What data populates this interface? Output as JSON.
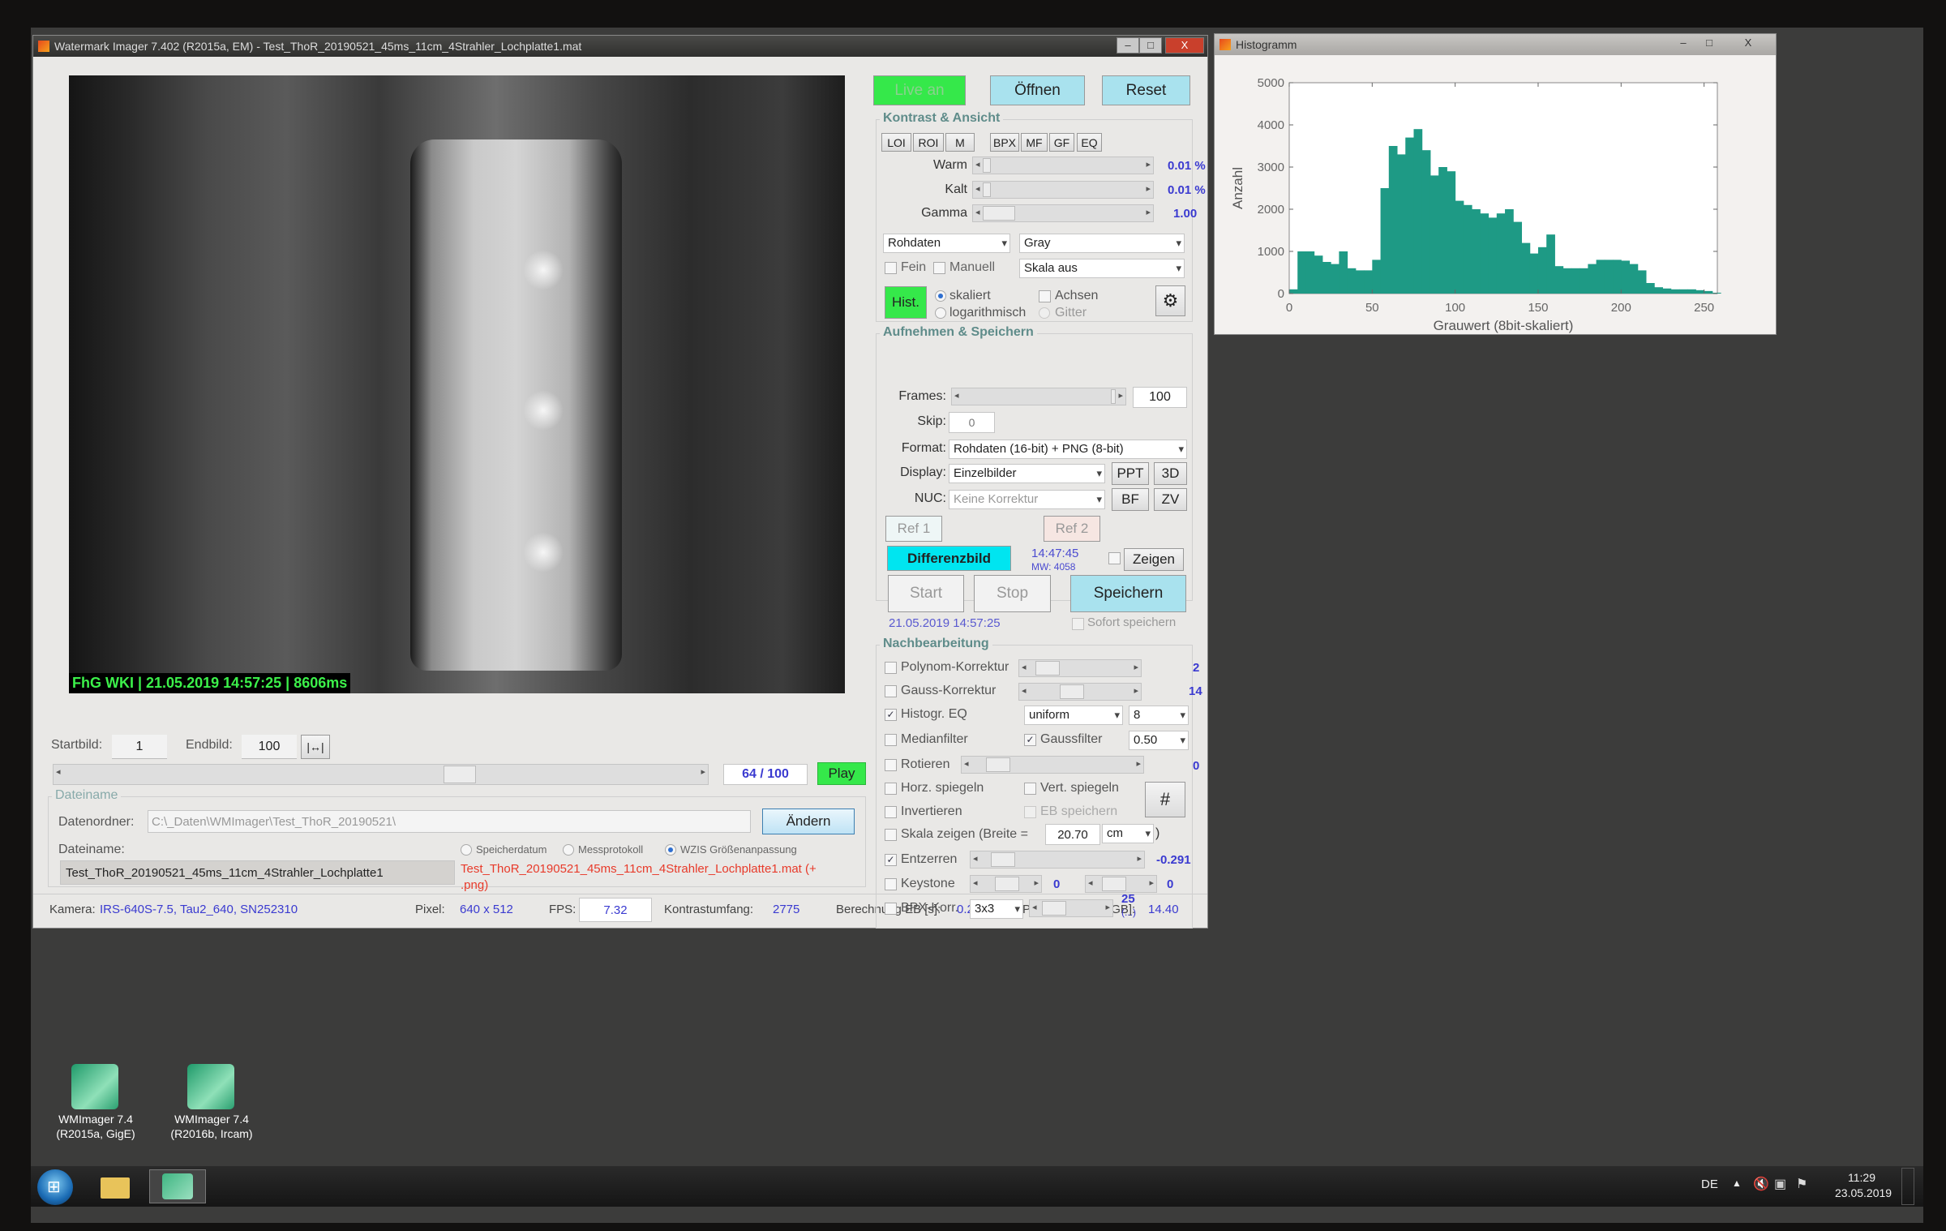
{
  "main_window": {
    "title": "Watermark Imager 7.402 (R2015a, EM) - Test_ThoR_20190521_45ms_11cm_4Strahler_Lochplatte1.mat",
    "overlay": "FhG WKI | 21.05.2019 14:57:25 | 8606ms"
  },
  "histogram_window": {
    "title": "Histogramm"
  },
  "window_buttons": {
    "min": "–",
    "max": "□",
    "close": "X"
  },
  "top_buttons": {
    "live": "Live an",
    "open": "Öffnen",
    "reset": "Reset"
  },
  "colors": {
    "green": "#35e84a",
    "cyan_light": "#a9e2ee",
    "cyan": "#00e5f0",
    "value_blue": "#3a3ad0",
    "red_text": "#e83a2a",
    "hist_fill": "#1e9a85"
  },
  "kontrast": {
    "title": "Kontrast & Ansicht",
    "tool_buttons": [
      "LOI",
      "ROI",
      "M",
      "BPX",
      "MF",
      "GF",
      "EQ"
    ],
    "warm_label": "Warm",
    "warm_value": "0.01 %",
    "kalt_label": "Kalt",
    "kalt_value": "0.01 %",
    "gamma_label": "Gamma",
    "gamma_value": "1.00",
    "data_select": "Rohdaten",
    "colormap_select": "Gray",
    "scale_select": "Skala aus",
    "fein": "Fein",
    "manuell": "Manuell",
    "hist_button": "Hist.",
    "skaliert": "skaliert",
    "log": "logarithmisch",
    "achsen": "Achsen",
    "gitter": "Gitter"
  },
  "aufnehmen": {
    "title": "Aufnehmen & Speichern",
    "frames_label": "Frames:",
    "frames_value": "100",
    "skip_label": "Skip:",
    "skip_value": "0",
    "format_label": "Format:",
    "format_value": "Rohdaten (16-bit) + PNG (8-bit)",
    "display_label": "Display:",
    "display_value": "Einzelbilder",
    "nuc_label": "NUC:",
    "nuc_value": "Keine Korrektur",
    "ppt": "PPT",
    "d3": "3D",
    "bf": "BF",
    "zv": "ZV",
    "ref1": "Ref 1",
    "ref2": "Ref 2",
    "diff": "Differenzbild",
    "ref_time": "14:47:45",
    "ref_mw": "MW: 4058",
    "zeigen": "Zeigen",
    "start": "Start",
    "stop": "Stop",
    "speichern": "Speichern",
    "timestamp": "21.05.2019 14:57:25",
    "sofort": "Sofort speichern"
  },
  "nachbearbeitung": {
    "title": "Nachbearbeitung",
    "polynom": {
      "label": "Polynom-Korrektur",
      "checked": false,
      "value": "2"
    },
    "gauss": {
      "label": "Gauss-Korrektur",
      "checked": false,
      "value": "14"
    },
    "histeq": {
      "label": "Histogr. EQ",
      "checked": true,
      "method": "uniform",
      "bins": "8"
    },
    "median": {
      "label": "Medianfilter",
      "checked": false
    },
    "gaussfilter": {
      "label": "Gaussfilter",
      "checked": true,
      "value": "0.50"
    },
    "rotieren": {
      "label": "Rotieren",
      "checked": false,
      "value": "0"
    },
    "horz": {
      "label": "Horz. spiegeln",
      "checked": false
    },
    "vert": {
      "label": "Vert. spiegeln",
      "checked": false
    },
    "invert": {
      "label": "Invertieren",
      "checked": false
    },
    "eb": {
      "label": "EB speichern",
      "checked": false
    },
    "grid_button": "#",
    "skala": {
      "label": "Skala zeigen (Breite =",
      "checked": false,
      "value": "20.70",
      "unit": "cm",
      "close": ")"
    },
    "entzerren": {
      "label": "Entzerren",
      "checked": true,
      "value": "-0.291"
    },
    "keystone": {
      "label": "Keystone",
      "checked": false,
      "value1": "0",
      "value2": "0"
    },
    "bpx": {
      "label": "BPX-Korr.",
      "checked": false,
      "kernel": "3x3",
      "value": "25",
      "more": "(...)"
    }
  },
  "playback": {
    "start_label": "Startbild:",
    "start_value": "1",
    "end_label": "Endbild:",
    "end_value": "100",
    "range_button": "|↔|",
    "counter": "64 / 100",
    "play": "Play",
    "position": 0.64
  },
  "dateiname": {
    "title": "Dateiname",
    "folder_label": "Datenordner:",
    "folder_value": "C:\\_Daten\\WMImager\\Test_ThoR_20190521\\",
    "change": "Ändern",
    "file_label": "Dateiname:",
    "opt1": "Speicherdatum",
    "opt2": "Messprotokoll",
    "opt3": "WZIS Größenanpassung",
    "file_value": "Test_ThoR_20190521_45ms_11cm_4Strahler_Lochplatte1",
    "output_line1": "Test_ThoR_20190521_45ms_11cm_4Strahler_Lochplatte1.mat (+",
    "output_line2": ".png)"
  },
  "status": {
    "kamera_label": "Kamera:",
    "kamera_value": "IRS-640S-7.5, Tau2_640, SN252310",
    "pixel_label": "Pixel:",
    "pixel_value": "640 x 512",
    "fps_label": "FPS:",
    "fps_value": "7.32",
    "kontrast_label": "Kontrastumfang:",
    "kontrast_value": "2775",
    "eb_label": "Berechnung EB [s]:",
    "eb_value": "0.236",
    "mem_label": "Phys. Speicher [GB]:",
    "mem_value": "14.40"
  },
  "desktop_icons": [
    {
      "line1": "WMImager 7.4",
      "line2": "(R2015a, GigE)"
    },
    {
      "line1": "WMImager 7.4",
      "line2": "(R2016b, Ircam)"
    }
  ],
  "taskbar": {
    "lang": "DE",
    "time": "11:29",
    "date": "23.05.2019"
  },
  "chart_data": {
    "type": "bar",
    "xlabel": "Grauwert (8bit-skaliert)",
    "ylabel": "Anzahl",
    "xlim": [
      0,
      255
    ],
    "ylim": [
      0,
      5000
    ],
    "xticks": [
      0,
      50,
      100,
      150,
      200,
      250
    ],
    "yticks": [
      0,
      1000,
      2000,
      3000,
      4000,
      5000
    ],
    "grid": false,
    "bin_width": 5,
    "x": [
      0,
      5,
      10,
      15,
      20,
      25,
      30,
      35,
      40,
      45,
      50,
      55,
      60,
      65,
      70,
      75,
      80,
      85,
      90,
      95,
      100,
      105,
      110,
      115,
      120,
      125,
      130,
      135,
      140,
      145,
      150,
      155,
      160,
      165,
      170,
      175,
      180,
      185,
      190,
      195,
      200,
      205,
      210,
      215,
      220,
      225,
      230,
      235,
      240,
      245,
      250,
      255
    ],
    "values": [
      100,
      1000,
      1000,
      900,
      750,
      700,
      1000,
      600,
      550,
      550,
      800,
      2500,
      3500,
      3300,
      3700,
      3900,
      3400,
      2800,
      3000,
      2900,
      2200,
      2100,
      2000,
      1900,
      1800,
      1900,
      2000,
      1700,
      1200,
      950,
      1100,
      1400,
      650,
      600,
      600,
      600,
      700,
      800,
      800,
      800,
      780,
      700,
      550,
      250,
      150,
      120,
      100,
      100,
      100,
      80,
      60,
      20
    ]
  }
}
